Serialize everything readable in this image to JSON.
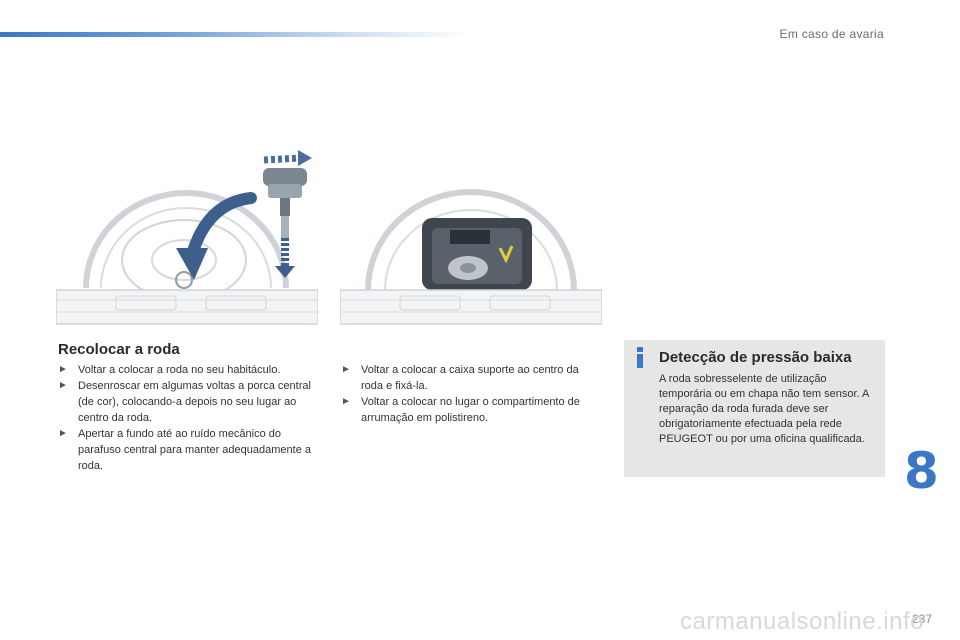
{
  "header": {
    "title": "Em caso de avaria"
  },
  "section": {
    "title": "Recolocar a roda",
    "column1": [
      {
        "icon": "arrow-bullet-icon",
        "text": "Voltar a colocar a roda no seu habitáculo."
      },
      {
        "icon": "arrow-bullet-icon",
        "text": "Desenroscar em algumas voltas a porca central (de cor), colocando-a depois no seu lugar ao centro da roda."
      },
      {
        "icon": "arrow-bullet-icon",
        "text": "Apertar a fundo até ao ruído mecânico do parafuso central para manter adequadamente a roda."
      }
    ],
    "column2": [
      {
        "icon": "arrow-bullet-icon",
        "text": "Voltar a colocar a caixa suporte ao centro da roda e fixá-la."
      },
      {
        "icon": "arrow-bullet-icon",
        "text": "Voltar a colocar no lugar o compartimento de arrumação em polistireno."
      }
    ]
  },
  "info": {
    "icon": "info-icon",
    "title": "Detecção de pressão baixa",
    "text": "A roda sobresselente de utilização temporária ou em chapa não tem sensor. A reparação da roda furada deve ser obrigatoriamente efectuada pela rede PEUGEOT ou por uma oficina qualificada."
  },
  "chapter": "8",
  "page_number": "237",
  "watermark": "carmanualsonline.info",
  "colors": {
    "accent": "#3a78c5",
    "info_bg": "#e6e6e6"
  }
}
